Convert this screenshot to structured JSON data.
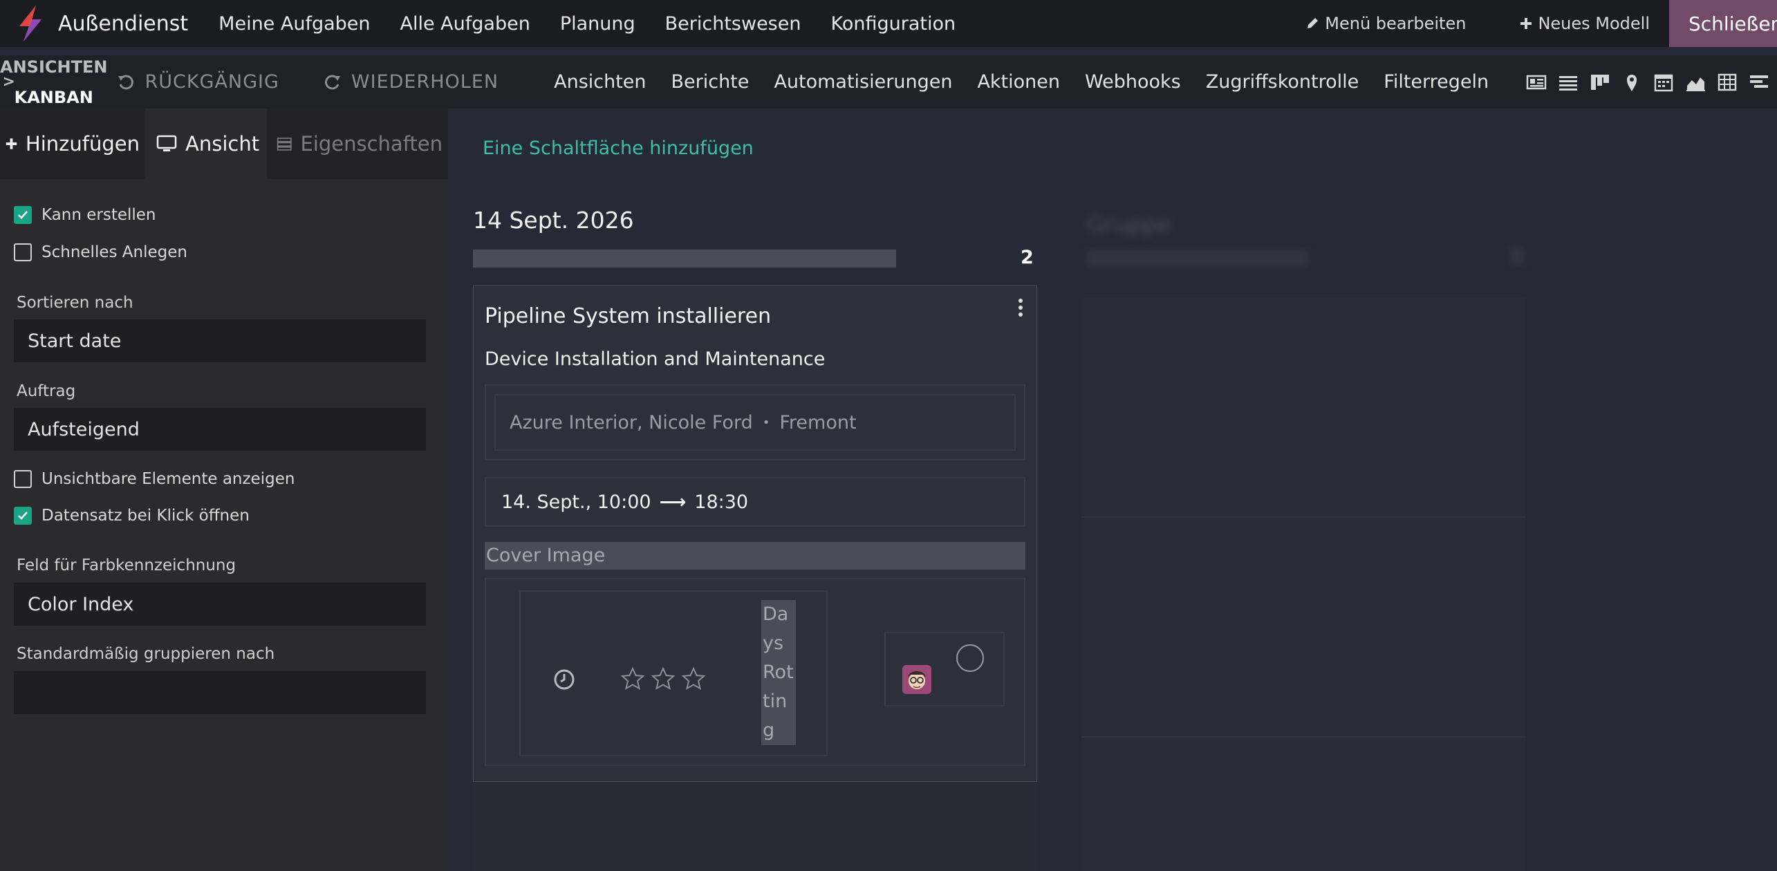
{
  "app": {
    "title": "Außendienst"
  },
  "topnav": {
    "items": [
      "Meine Aufgaben",
      "Alle Aufgaben",
      "Planung",
      "Berichtswesen",
      "Konfiguration"
    ]
  },
  "top_right": {
    "edit_menu": "Menü bearbeiten",
    "new_model": "Neues Modell",
    "close": "Schließen"
  },
  "subbar": {
    "breadcrumb_parent": "ANSICHTEN",
    "breadcrumb_sep": ">",
    "breadcrumb_current": "KANBAN",
    "undo": "RÜCKGÄNGIG",
    "redo": "WIEDERHOLEN",
    "studio_nav": [
      "Ansichten",
      "Berichte",
      "Automatisierungen",
      "Aktionen",
      "Webhooks",
      "Zugriffskontrolle",
      "Filterregeln"
    ],
    "view_icons": [
      "form-view-icon",
      "list-view-icon",
      "kanban-view-icon",
      "map-view-icon",
      "calendar-view-icon",
      "graph-view-icon",
      "pivot-view-icon",
      "gantt-view-icon",
      "activity-view-icon"
    ]
  },
  "sidebar": {
    "tabs": {
      "add": "Hinzufügen",
      "view": "Ansicht",
      "properties": "Eigenschaften"
    },
    "can_create": {
      "label": "Kann erstellen",
      "checked": true
    },
    "quick_create": {
      "label": "Schnelles Anlegen",
      "checked": false
    },
    "sort_by": {
      "label": "Sortieren nach",
      "value": "Start date"
    },
    "order": {
      "label": "Auftrag",
      "value": "Aufsteigend"
    },
    "show_invisible": {
      "label": "Unsichtbare Elemente anzeigen",
      "checked": false
    },
    "open_on_click": {
      "label": "Datensatz bei Klick öffnen",
      "checked": true
    },
    "color_field": {
      "label": "Feld für Farbkennzeichnung",
      "value": "Color Index"
    },
    "default_group": {
      "label": "Standardmäßig gruppieren nach",
      "value": ""
    }
  },
  "main": {
    "add_button": "Eine Schaltfläche hinzufügen",
    "column": {
      "title": "14 Sept. 2026",
      "count": "2"
    },
    "card": {
      "title": "Pipeline System installieren",
      "project": "Device Installation and Maintenance",
      "partner": "Azure Interior, Nicole Ford",
      "partner_sep": "•",
      "city": "Fremont",
      "date_start": "14. Sept., 10:00",
      "date_arrow": "⟶",
      "date_end": "18:30",
      "cover_image": "Cover Image",
      "days_rotting": "Days Rotting",
      "priority_stars": 3
    },
    "ghost_column": {
      "title": "Gruppe"
    }
  },
  "colors": {
    "accent_teal": "#3cc0a5",
    "checkbox_green": "#1aa486",
    "close_button": "#714b67",
    "topbar": "#1b1c21",
    "main_bg": "#262a36"
  }
}
